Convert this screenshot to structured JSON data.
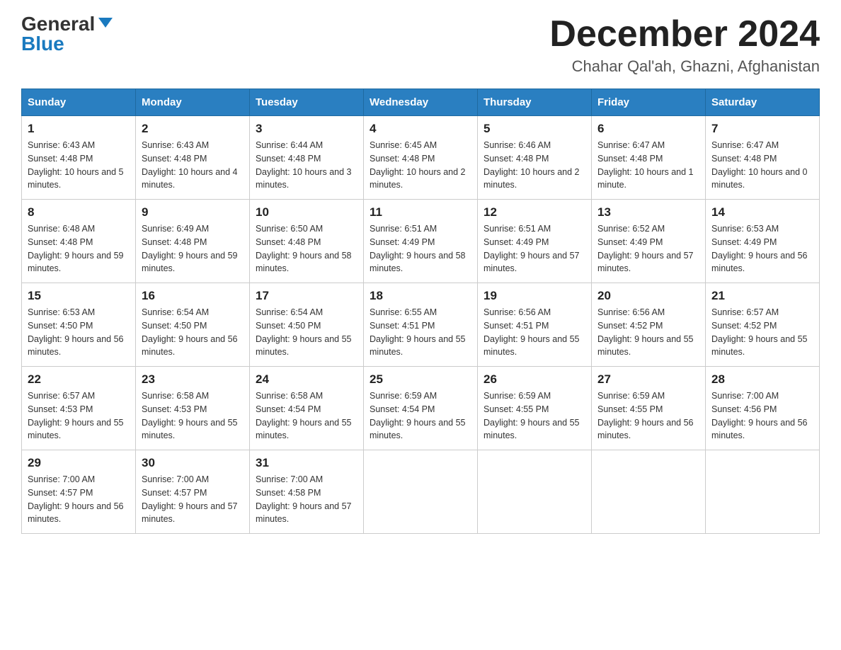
{
  "header": {
    "logo_general": "General",
    "logo_blue": "Blue",
    "month_title": "December 2024",
    "location": "Chahar Qal'ah, Ghazni, Afghanistan"
  },
  "columns": [
    "Sunday",
    "Monday",
    "Tuesday",
    "Wednesday",
    "Thursday",
    "Friday",
    "Saturday"
  ],
  "weeks": [
    [
      {
        "day": "1",
        "sunrise": "6:43 AM",
        "sunset": "4:48 PM",
        "daylight": "10 hours and 5 minutes."
      },
      {
        "day": "2",
        "sunrise": "6:43 AM",
        "sunset": "4:48 PM",
        "daylight": "10 hours and 4 minutes."
      },
      {
        "day": "3",
        "sunrise": "6:44 AM",
        "sunset": "4:48 PM",
        "daylight": "10 hours and 3 minutes."
      },
      {
        "day": "4",
        "sunrise": "6:45 AM",
        "sunset": "4:48 PM",
        "daylight": "10 hours and 2 minutes."
      },
      {
        "day": "5",
        "sunrise": "6:46 AM",
        "sunset": "4:48 PM",
        "daylight": "10 hours and 2 minutes."
      },
      {
        "day": "6",
        "sunrise": "6:47 AM",
        "sunset": "4:48 PM",
        "daylight": "10 hours and 1 minute."
      },
      {
        "day": "7",
        "sunrise": "6:47 AM",
        "sunset": "4:48 PM",
        "daylight": "10 hours and 0 minutes."
      }
    ],
    [
      {
        "day": "8",
        "sunrise": "6:48 AM",
        "sunset": "4:48 PM",
        "daylight": "9 hours and 59 minutes."
      },
      {
        "day": "9",
        "sunrise": "6:49 AM",
        "sunset": "4:48 PM",
        "daylight": "9 hours and 59 minutes."
      },
      {
        "day": "10",
        "sunrise": "6:50 AM",
        "sunset": "4:48 PM",
        "daylight": "9 hours and 58 minutes."
      },
      {
        "day": "11",
        "sunrise": "6:51 AM",
        "sunset": "4:49 PM",
        "daylight": "9 hours and 58 minutes."
      },
      {
        "day": "12",
        "sunrise": "6:51 AM",
        "sunset": "4:49 PM",
        "daylight": "9 hours and 57 minutes."
      },
      {
        "day": "13",
        "sunrise": "6:52 AM",
        "sunset": "4:49 PM",
        "daylight": "9 hours and 57 minutes."
      },
      {
        "day": "14",
        "sunrise": "6:53 AM",
        "sunset": "4:49 PM",
        "daylight": "9 hours and 56 minutes."
      }
    ],
    [
      {
        "day": "15",
        "sunrise": "6:53 AM",
        "sunset": "4:50 PM",
        "daylight": "9 hours and 56 minutes."
      },
      {
        "day": "16",
        "sunrise": "6:54 AM",
        "sunset": "4:50 PM",
        "daylight": "9 hours and 56 minutes."
      },
      {
        "day": "17",
        "sunrise": "6:54 AM",
        "sunset": "4:50 PM",
        "daylight": "9 hours and 55 minutes."
      },
      {
        "day": "18",
        "sunrise": "6:55 AM",
        "sunset": "4:51 PM",
        "daylight": "9 hours and 55 minutes."
      },
      {
        "day": "19",
        "sunrise": "6:56 AM",
        "sunset": "4:51 PM",
        "daylight": "9 hours and 55 minutes."
      },
      {
        "day": "20",
        "sunrise": "6:56 AM",
        "sunset": "4:52 PM",
        "daylight": "9 hours and 55 minutes."
      },
      {
        "day": "21",
        "sunrise": "6:57 AM",
        "sunset": "4:52 PM",
        "daylight": "9 hours and 55 minutes."
      }
    ],
    [
      {
        "day": "22",
        "sunrise": "6:57 AM",
        "sunset": "4:53 PM",
        "daylight": "9 hours and 55 minutes."
      },
      {
        "day": "23",
        "sunrise": "6:58 AM",
        "sunset": "4:53 PM",
        "daylight": "9 hours and 55 minutes."
      },
      {
        "day": "24",
        "sunrise": "6:58 AM",
        "sunset": "4:54 PM",
        "daylight": "9 hours and 55 minutes."
      },
      {
        "day": "25",
        "sunrise": "6:59 AM",
        "sunset": "4:54 PM",
        "daylight": "9 hours and 55 minutes."
      },
      {
        "day": "26",
        "sunrise": "6:59 AM",
        "sunset": "4:55 PM",
        "daylight": "9 hours and 55 minutes."
      },
      {
        "day": "27",
        "sunrise": "6:59 AM",
        "sunset": "4:55 PM",
        "daylight": "9 hours and 56 minutes."
      },
      {
        "day": "28",
        "sunrise": "7:00 AM",
        "sunset": "4:56 PM",
        "daylight": "9 hours and 56 minutes."
      }
    ],
    [
      {
        "day": "29",
        "sunrise": "7:00 AM",
        "sunset": "4:57 PM",
        "daylight": "9 hours and 56 minutes."
      },
      {
        "day": "30",
        "sunrise": "7:00 AM",
        "sunset": "4:57 PM",
        "daylight": "9 hours and 57 minutes."
      },
      {
        "day": "31",
        "sunrise": "7:00 AM",
        "sunset": "4:58 PM",
        "daylight": "9 hours and 57 minutes."
      },
      null,
      null,
      null,
      null
    ]
  ]
}
